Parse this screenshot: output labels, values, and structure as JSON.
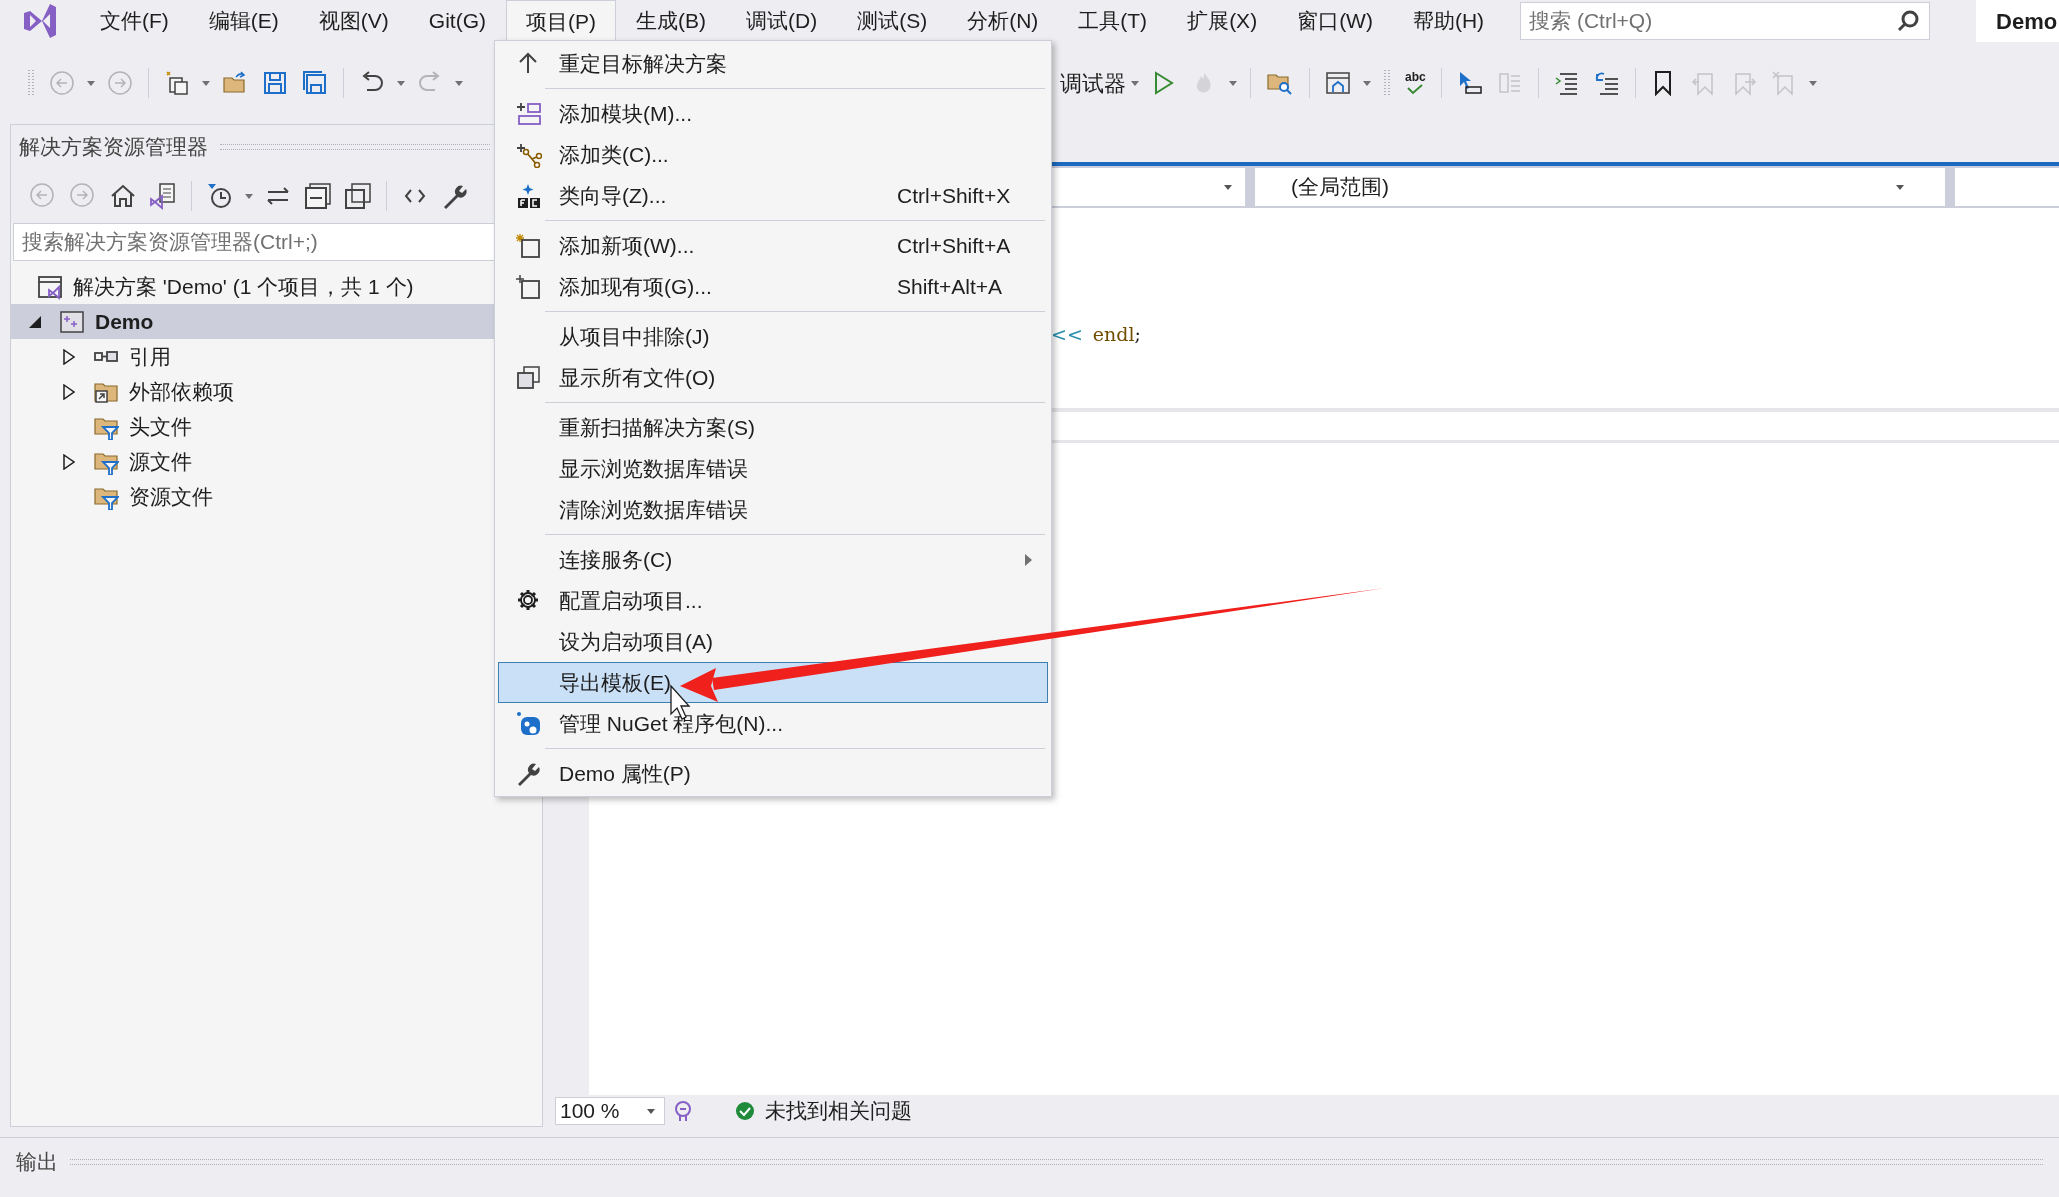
{
  "menu_bar": {
    "items": [
      {
        "label": "文件(F)",
        "selected": false
      },
      {
        "label": "编辑(E)",
        "selected": false
      },
      {
        "label": "视图(V)",
        "selected": false
      },
      {
        "label": "Git(G)",
        "selected": false
      },
      {
        "label": "项目(P)",
        "selected": true
      },
      {
        "label": "生成(B)",
        "selected": false
      },
      {
        "label": "调试(D)",
        "selected": false
      },
      {
        "label": "测试(S)",
        "selected": false
      },
      {
        "label": "分析(N)",
        "selected": false
      },
      {
        "label": "工具(T)",
        "selected": false
      },
      {
        "label": "扩展(X)",
        "selected": false
      },
      {
        "label": "窗口(W)",
        "selected": false
      },
      {
        "label": "帮助(H)",
        "selected": false
      }
    ],
    "search": {
      "placeholder": "搜索 (Ctrl+Q)"
    },
    "solution_name": "Demo"
  },
  "toolbar": {
    "debugger_label": "调试器",
    "spell_check_label": "abc"
  },
  "solution_explorer": {
    "title": "解决方案资源管理器",
    "search": {
      "placeholder": "搜索解决方案资源管理器(Ctrl+;)"
    },
    "tree": [
      {
        "label": "解决方案 'Demo' (1 个项目，共 1 个)",
        "kind": "solution",
        "selected": false,
        "children": [
          {
            "label": "Demo",
            "kind": "project",
            "expandable": true,
            "expanded": true,
            "selected": true,
            "children": [
              {
                "label": "引用",
                "kind": "references",
                "expandable": true,
                "expanded": false,
                "selected": false
              },
              {
                "label": "外部依赖项",
                "kind": "external",
                "expandable": true,
                "expanded": false,
                "selected": false
              },
              {
                "label": "头文件",
                "kind": "filter",
                "expandable": false,
                "selected": false
              },
              {
                "label": "源文件",
                "kind": "filter",
                "expandable": true,
                "expanded": false,
                "selected": false
              },
              {
                "label": "资源文件",
                "kind": "filter",
                "expandable": false,
                "selected": false
              }
            ]
          }
        ]
      }
    ]
  },
  "context_menu": {
    "groups": [
      [
        {
          "label": "重定目标解决方案",
          "selected": false,
          "submenu": false
        }
      ],
      [
        {
          "label": "添加模块(M)...",
          "selected": false,
          "submenu": false
        },
        {
          "label": "添加类(C)...",
          "selected": false,
          "submenu": false
        },
        {
          "label": "类向导(Z)...",
          "shortcut": "Ctrl+Shift+X",
          "selected": false,
          "submenu": false
        }
      ],
      [
        {
          "label": "添加新项(W)...",
          "shortcut": "Ctrl+Shift+A",
          "selected": false,
          "submenu": false
        },
        {
          "label": "添加现有项(G)...",
          "shortcut": "Shift+Alt+A",
          "selected": false,
          "submenu": false
        }
      ],
      [
        {
          "label": "从项目中排除(J)",
          "selected": false,
          "submenu": false
        },
        {
          "label": "显示所有文件(O)",
          "selected": false,
          "submenu": false
        }
      ],
      [
        {
          "label": "重新扫描解决方案(S)",
          "selected": false,
          "submenu": false
        },
        {
          "label": "显示浏览数据库错误",
          "selected": false,
          "submenu": false
        },
        {
          "label": "清除浏览数据库错误",
          "selected": false,
          "submenu": false
        }
      ],
      [
        {
          "label": "连接服务(C)",
          "selected": false,
          "submenu": true
        },
        {
          "label": "配置启动项目...",
          "selected": false,
          "submenu": false
        },
        {
          "label": "设为启动项目(A)",
          "selected": false,
          "submenu": false
        },
        {
          "label": "导出模板(E)",
          "selected": true,
          "submenu": false
        },
        {
          "label": "管理 NuGet 程序包(N)...",
          "selected": false,
          "submenu": false
        }
      ],
      [
        {
          "label": "Demo 属性(P)",
          "selected": false,
          "submenu": false
        }
      ]
    ]
  },
  "editor": {
    "scope": "(全局范围)",
    "code": [
      {
        "text": "<<",
        "kind": "operator"
      },
      {
        "text": "endl",
        "kind": "identifier"
      },
      {
        "text": ";",
        "kind": "punctuation"
      }
    ],
    "zoom": "100 %",
    "issues": "未找到相关问题"
  },
  "output_panel": {
    "title": "输出"
  }
}
